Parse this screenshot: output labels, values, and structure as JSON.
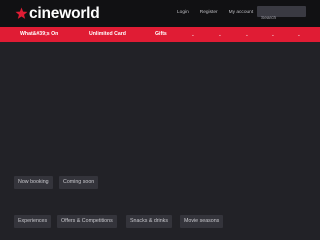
{
  "header": {
    "logo_text": "cineworld",
    "links": {
      "login": "Login",
      "register": "Register",
      "account": "My account"
    },
    "search_placeholder": "Search"
  },
  "nav": {
    "items": [
      "What&#39;s On",
      "Unlimited Card",
      "Gifts"
    ],
    "arrow_icons": [
      "chevron-down-icon",
      "chevron-down-icon",
      "chevron-down-icon",
      "chevron-down-icon",
      "chevron-down-icon"
    ],
    "arrow_glyph": "⌄"
  },
  "tabs": {
    "now_booking": "Now booking",
    "coming_soon": "Coming soon"
  },
  "categories": {
    "experiences": "Experiences",
    "offers": "Offers & Competitions",
    "snacks": "Snacks & drinks",
    "movie_seasons": "Movie seasons"
  },
  "colors": {
    "brand_red": "#e01c34",
    "topbar": "#111113",
    "background": "#222227"
  }
}
